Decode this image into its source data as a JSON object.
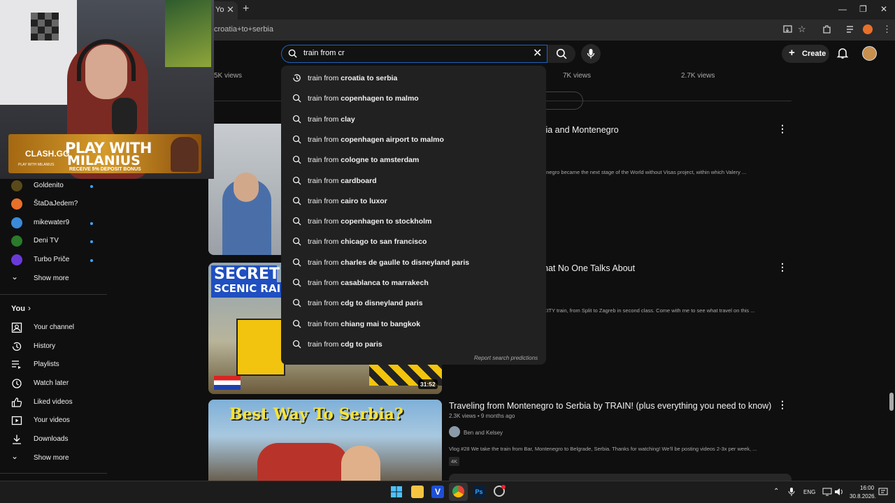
{
  "browser": {
    "tab_label": "Yo",
    "tab_close": "✕",
    "new_tab": "+",
    "url": "croatia+to+serbia",
    "window_controls": [
      "—",
      "❐",
      "✕"
    ]
  },
  "header": {
    "search_value": "train from cr",
    "clear_glyph": "✕",
    "create_label": "Create",
    "icons": [
      "search-icon",
      "mic-icon",
      "bell-icon",
      "avatar"
    ]
  },
  "overlay": {
    "brand": "CLASH.GG",
    "brand_sub": "PLAY WITH MILANIUS",
    "title_line1": "PLAY WITH",
    "title_line2": "MILANIUS",
    "bonus": "RECEIVE 5% DEPOSIT BONUS"
  },
  "suggestions": [
    {
      "prefix": "train from ",
      "bold": "croatia to serbia",
      "icon": "history-icon"
    },
    {
      "prefix": "train from ",
      "bold": "copenhagen to malmo",
      "icon": "search-icon"
    },
    {
      "prefix": "train from ",
      "bold": "clay",
      "icon": "search-icon"
    },
    {
      "prefix": "train from ",
      "bold": "copenhagen airport to malmo",
      "icon": "search-icon"
    },
    {
      "prefix": "train from ",
      "bold": "cologne to amsterdam",
      "icon": "search-icon"
    },
    {
      "prefix": "train from ",
      "bold": "cardboard",
      "icon": "search-icon"
    },
    {
      "prefix": "train from ",
      "bold": "cairo to luxor",
      "icon": "search-icon"
    },
    {
      "prefix": "train from ",
      "bold": "copenhagen to stockholm",
      "icon": "search-icon"
    },
    {
      "prefix": "train from ",
      "bold": "chicago to san francisco",
      "icon": "search-icon"
    },
    {
      "prefix": "train from ",
      "bold": "charles de gaulle to disneyland paris",
      "icon": "search-icon"
    },
    {
      "prefix": "train from ",
      "bold": "casablanca to marrakech",
      "icon": "search-icon"
    },
    {
      "prefix": "train from ",
      "bold": "cdg to disneyland paris",
      "icon": "search-icon"
    },
    {
      "prefix": "train from ",
      "bold": "chiang mai to bangkok",
      "icon": "search-icon"
    },
    {
      "prefix": "train from ",
      "bold": "cdg to paris",
      "icon": "search-icon"
    }
  ],
  "report_label": "Report search predictions",
  "sidebar": {
    "subscriptions": [
      {
        "label": "Goldenito",
        "color": "#5a4a1a",
        "dot": true
      },
      {
        "label": "ŠtaDaJedem?",
        "color": "#e8702a",
        "dot": false
      },
      {
        "label": "mikewater9",
        "color": "#3b8ad9",
        "dot": true
      },
      {
        "label": "Deni TV",
        "color": "#2a7a2a",
        "dot": true
      },
      {
        "label": "Turbo Priče",
        "color": "#6a3ad9",
        "dot": true
      }
    ],
    "show_more_1": "Show more",
    "you_label": "You",
    "you_items": [
      {
        "label": "Your channel",
        "icon": "channel-icon"
      },
      {
        "label": "History",
        "icon": "history-icon"
      },
      {
        "label": "Playlists",
        "icon": "playlists-icon"
      },
      {
        "label": "Watch later",
        "icon": "clock-icon"
      },
      {
        "label": "Liked videos",
        "icon": "thumb-up-icon"
      },
      {
        "label": "Your videos",
        "icon": "video-icon"
      },
      {
        "label": "Downloads",
        "icon": "download-icon"
      }
    ],
    "show_more_2": "Show more"
  },
  "top_row_views": [
    "5K views",
    "7K views",
    "2.7K views"
  ],
  "videos": [
    {
      "title_visible": "tia and Montenegro",
      "desc_visible": "enegro became the next stage of the World without Visas project, within which Valery ..."
    },
    {
      "title_visible": "hat No One Talks About",
      "desc_visible": "CITY train, from Split to Zagreb in second class. Come with me to see what travel on this ...",
      "thumb_text1": "SECRET",
      "thumb_text2": "SCENIC RAILW",
      "duration": "31:52"
    },
    {
      "title": "Traveling from Montenegro to Serbia by TRAIN! (plus everything you need to know)",
      "meta": "2.3K views • 9 months ago",
      "channel": "Ben and Kelsey",
      "desc": "Vlog #28 We take the train from Bar, Montenegro to Belgrade, Serbia. Thanks for watching! We'll be posting videos 2-3x per week, ...",
      "badge": "4K",
      "thumb_text": "Best Way To Serbia?"
    }
  ],
  "taskbar": {
    "lang": "ENG",
    "time": "16:00",
    "date": "30.8.2026."
  },
  "colors": {
    "accent_blue": "#3ea6ff",
    "search_border": "#1c62b9"
  }
}
